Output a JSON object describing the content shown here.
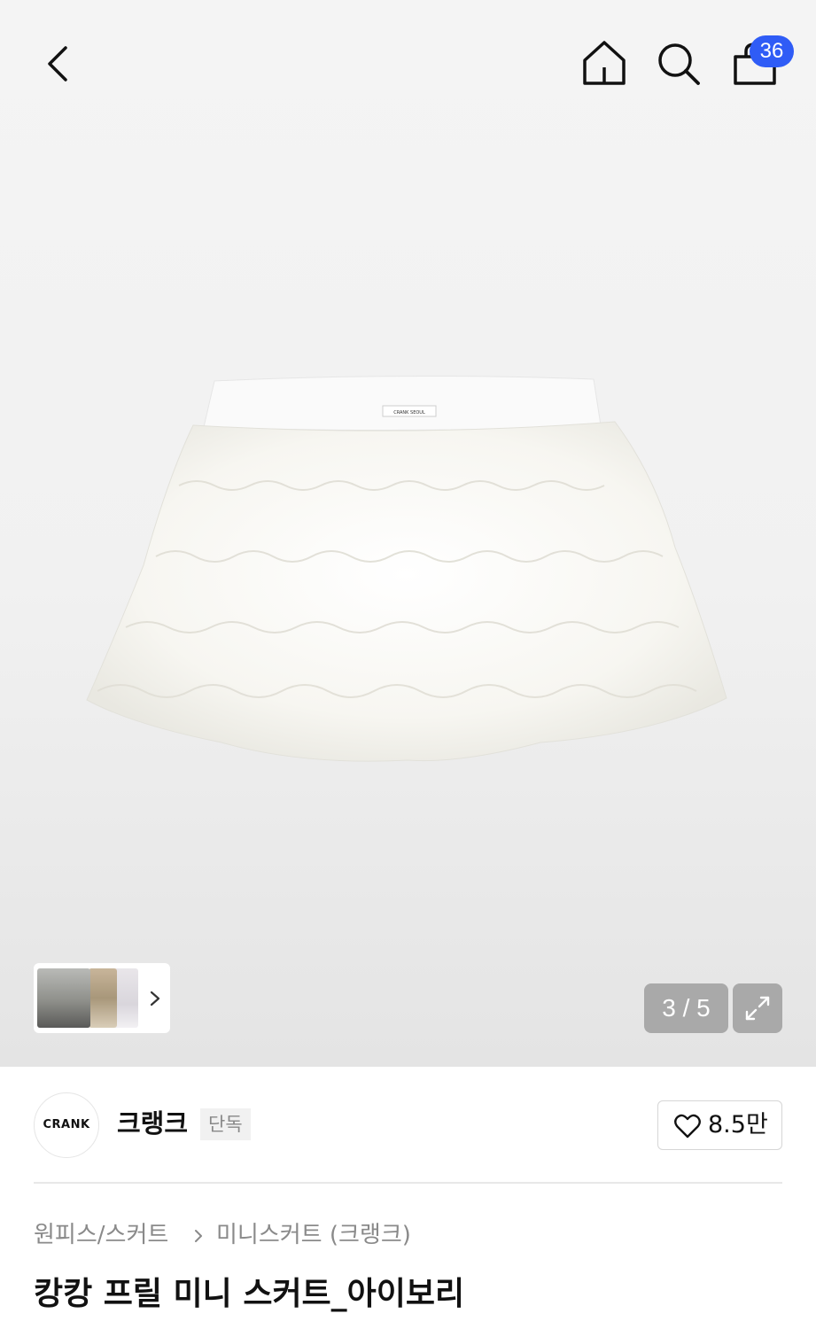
{
  "header": {
    "icons": [
      "back-icon",
      "home-icon",
      "search-icon",
      "cart-icon"
    ],
    "cart_badge": "36",
    "badge_color": "#2f5cf6"
  },
  "gallery": {
    "counter": "3 / 5",
    "expand_icon": "expand-icon",
    "thumbnail_more_icon": "chevron-right-icon"
  },
  "brand": {
    "logo_text": "CRANK",
    "name": "크랭크",
    "tag": "단독",
    "like_icon": "heart-icon",
    "like_count": "8.5만"
  },
  "breadcrumb": {
    "category": "원피스/스커트",
    "subcategory": "미니스커트 (크랭크)"
  },
  "product": {
    "title": "캉캉 프릴 미니 스커트_아이보리",
    "label_text": "CRANK SEOUL"
  }
}
